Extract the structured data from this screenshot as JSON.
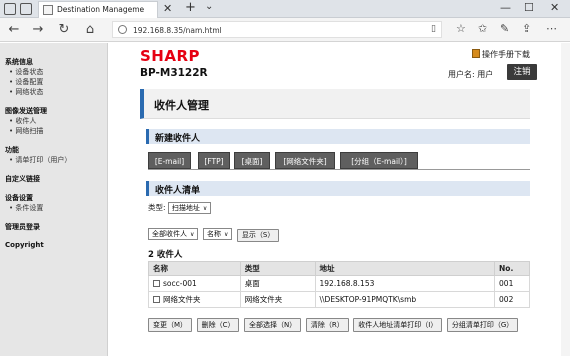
{
  "browser": {
    "tab_title": "Destination Manageme",
    "url": "192.168.8.35/nam.html"
  },
  "sidebar": {
    "groups": [
      {
        "title": "系统信息",
        "items": [
          "设备状态",
          "设备配置",
          "网络状态"
        ]
      },
      {
        "title": "图像发送管理",
        "items": [
          "收件人",
          "网络扫描"
        ]
      },
      {
        "title": "功能",
        "items": [
          "请单打印（用户）"
        ]
      },
      {
        "title": "自定义链接",
        "items": []
      },
      {
        "title": "设备设置",
        "items": [
          "条件设置"
        ]
      },
      {
        "title": "管理员登录",
        "items": []
      },
      {
        "title": "Copyright",
        "items": []
      }
    ]
  },
  "header": {
    "logo": "SHARP",
    "model": "BP-M3122R",
    "manual_link": "操作手册下载",
    "user_label": "用户名: 用户",
    "logout": "注销"
  },
  "page_title": "收件人管理",
  "new_recipient": {
    "title": "新建收件人",
    "tabs": [
      "[E-mail]",
      "[FTP]",
      "[桌面]",
      "[网络文件夹]",
      "[分组（E-mail）]"
    ]
  },
  "recipient_list": {
    "title": "收件人清单",
    "type_label": "类型:",
    "type_value": "扫描地址",
    "filter_value": "全部收件人",
    "sort_value": "名称",
    "show_button": "显示（S）",
    "count": "2 收件人",
    "columns": [
      "名称",
      "类型",
      "地址",
      "No."
    ],
    "rows": [
      {
        "name": "socc-001",
        "type": "桌面",
        "address": "192.168.8.153",
        "no": "001"
      },
      {
        "name": "网络文件夹",
        "type": "网络文件夹",
        "address": "\\\\DESKTOP-91PMQTK\\smb",
        "no": "002"
      }
    ]
  },
  "actions": [
    "变更（M）",
    "删除（C）",
    "全部选择（N）",
    "清除（R）",
    "收件人地址清单打印（I）",
    "分组清单打印（G）"
  ]
}
